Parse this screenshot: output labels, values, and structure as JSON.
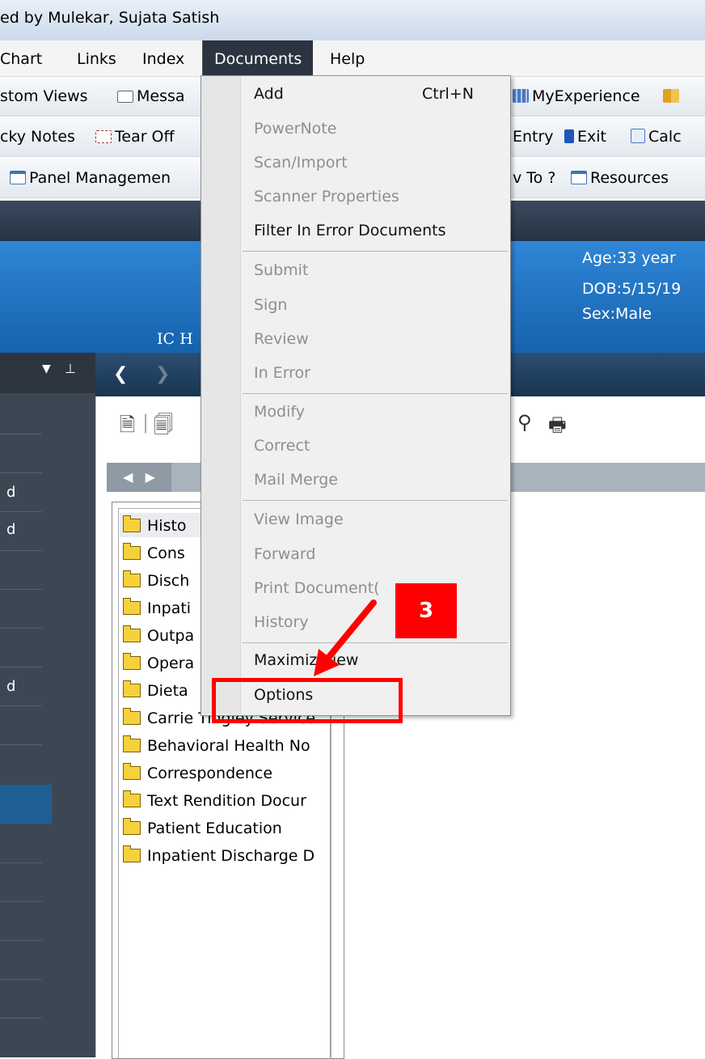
{
  "window": {
    "title": "ed by Mulekar, Sujata Satish"
  },
  "menubar": {
    "items": [
      "Chart",
      "Links",
      "Index",
      "Documents",
      "Help"
    ]
  },
  "toolbar1": {
    "custom_views": "stom Views",
    "messages": "Messa",
    "myexperience": "MyExperience"
  },
  "toolbar2": {
    "sticky_notes": "cky Notes",
    "tear_off": "Tear Off",
    "entry": "Entry",
    "exit": "Exit",
    "calc": "Calc"
  },
  "toolbar3": {
    "panel_management": "Panel Managemen",
    "how_to": "v To ?",
    "resources": "Resources"
  },
  "banner": {
    "age": "Age:33 year",
    "dob": "DOB:5/15/19",
    "sex": "Sex:Male",
    "ic": "IC H"
  },
  "left_panel": {
    "marks": [
      "d",
      "d",
      "d"
    ]
  },
  "tree": {
    "folders": [
      "Histo",
      "Cons",
      "Disch",
      "Inpati",
      "Outpa",
      "Opera",
      "Dieta",
      "Carrie Tingley Service",
      "Behavioral Health No",
      "Correspondence",
      "Text Rendition Docur",
      "Patient Education",
      "Inpatient Discharge D"
    ]
  },
  "documents_menu": {
    "add": "Add",
    "add_shortcut": "Ctrl+N",
    "powernote": "PowerNote",
    "scan_import": "Scan/Import",
    "scanner_properties": "Scanner Properties",
    "filter_in_error": "Filter In Error Documents",
    "submit": "Submit",
    "sign": "Sign",
    "review": "Review",
    "in_error": "In Error",
    "modify": "Modify",
    "correct": "Correct",
    "mail_merge": "Mail Merge",
    "view_image": "View Image",
    "forward": "Forward",
    "print_document": "Print Document(",
    "history": "History",
    "maximize_view": "Maximiz   View",
    "options": "Options"
  },
  "annotation": {
    "step": "3",
    "color": "#ff0000"
  },
  "colors": {
    "menu_active": "#2c3441",
    "banner": "#1f78c9",
    "left_panel": "#3d4754",
    "disabled_text": "#8e8e8e"
  },
  "icons": [
    "custom-views-icon",
    "message-icon",
    "myexperience-icon",
    "book-icon",
    "tear-off-icon",
    "exit-icon",
    "calculator-icon",
    "panel-management-icon",
    "resources-icon",
    "folder-icon",
    "back-arrow-icon",
    "forward-arrow-icon",
    "pin-icon"
  ]
}
